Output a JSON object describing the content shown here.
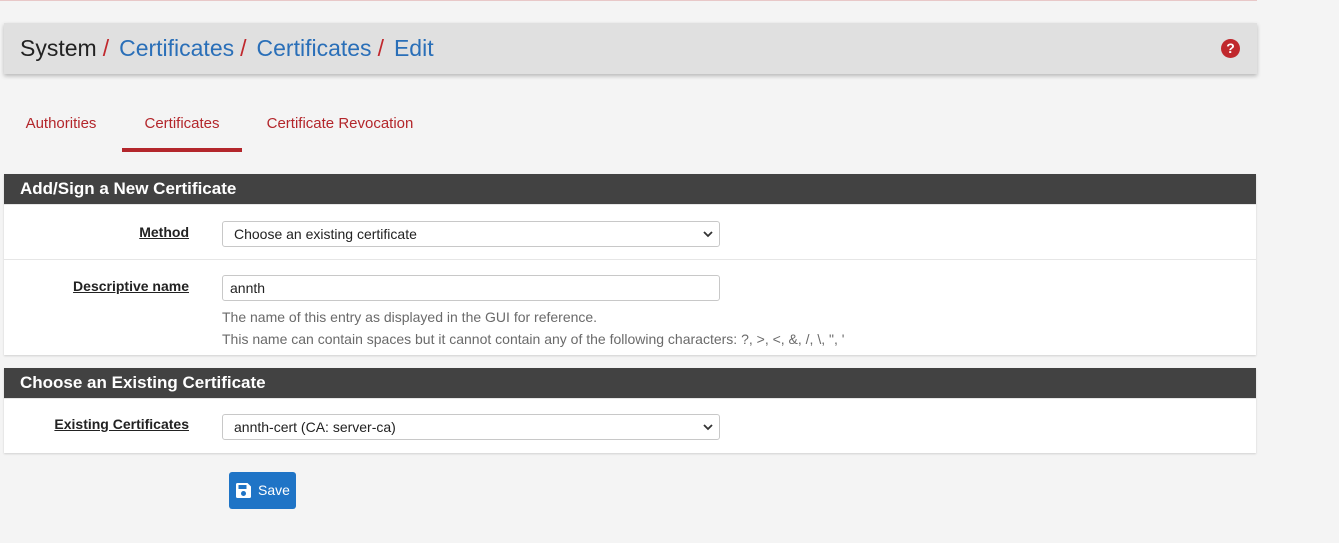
{
  "breadcrumb": {
    "root": "System",
    "separator": "/",
    "items": [
      "Certificates",
      "Certificates",
      "Edit"
    ]
  },
  "help_icon": "question-icon",
  "tabs": [
    {
      "label": "Authorities",
      "active": false
    },
    {
      "label": "Certificates",
      "active": true
    },
    {
      "label": "Certificate Revocation",
      "active": false
    }
  ],
  "section_new": {
    "title": "Add/Sign a New Certificate",
    "method_label": "Method",
    "method_value": "Choose an existing certificate",
    "name_label": "Descriptive name",
    "name_value": "annth",
    "help_line1": "The name of this entry as displayed in the GUI for reference.",
    "help_line2": "This name can contain spaces but it cannot contain any of the following characters: ?, >, <, &, /, \\, \", '"
  },
  "section_existing": {
    "title": "Choose an Existing Certificate",
    "existing_label": "Existing Certificates",
    "existing_value": "annth-cert (CA: server-ca)"
  },
  "save_button": {
    "label": "Save",
    "icon": "floppy-disk-icon"
  },
  "colors": {
    "accent_red": "#b3262b",
    "link_blue": "#2a6fb8",
    "panel_header": "#424242",
    "button_blue": "#1f74c6"
  }
}
